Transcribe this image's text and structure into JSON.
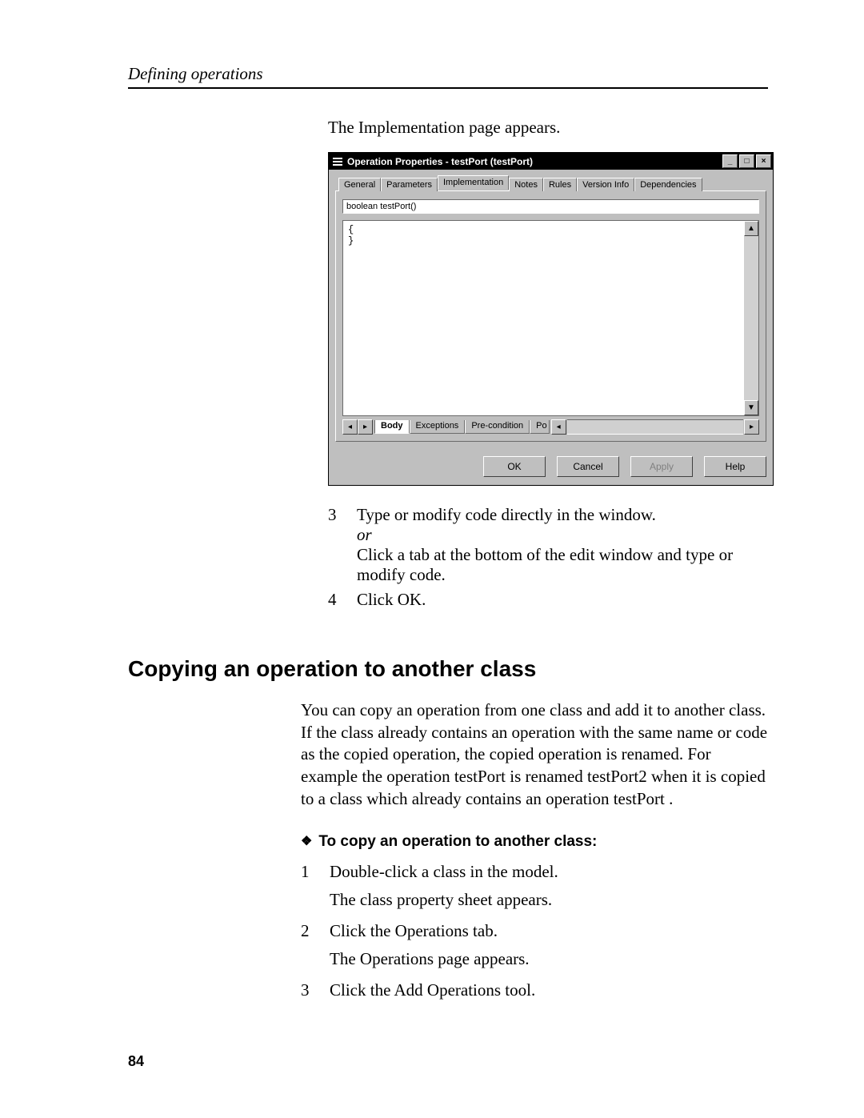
{
  "running_header": "Defining operations",
  "intro_line": "The Implementation page appears.",
  "dialog": {
    "title": "Operation Properties - testPort (testPort)",
    "win_controls": {
      "minimize": "_",
      "maximize": "□",
      "close": "×"
    },
    "tabs": [
      "General",
      "Parameters",
      "Implementation",
      "Notes",
      "Rules",
      "Version Info",
      "Dependencies"
    ],
    "active_tab_index": 2,
    "signature": "boolean testPort()",
    "editor_content": "{\n}",
    "bottom_tabs": [
      "Body",
      "Exceptions",
      "Pre-condition",
      "Po"
    ],
    "active_bottom_index": 0,
    "buttons": {
      "ok": "OK",
      "cancel": "Cancel",
      "apply": "Apply",
      "help": "Help"
    }
  },
  "step3": {
    "num": "3",
    "line1": "Type or modify code directly in the window.",
    "or": "or",
    "line2": "Click a tab at the bottom of the edit window and type or modify code."
  },
  "step4": {
    "num": "4",
    "text": "Click OK."
  },
  "section_heading": "Copying an operation to another class",
  "section_para": "You can copy an operation from one class and add it to another class. If the class already contains an operation with the same name or code as the copied operation, the copied operation is renamed. For example the operation testPort is renamed testPort2 when it is copied to a class which already contains an operation testPort .",
  "howto_heading": "To copy an operation to another class:",
  "howto_glyph": "❖",
  "sub_steps": [
    {
      "num": "1",
      "text": "Double-click a class in the model.",
      "result": "The class property sheet appears."
    },
    {
      "num": "2",
      "text": "Click the Operations tab.",
      "result": "The Operations page appears."
    },
    {
      "num": "3",
      "text": "Click the Add Operations tool.",
      "result": ""
    }
  ],
  "page_number": "84"
}
